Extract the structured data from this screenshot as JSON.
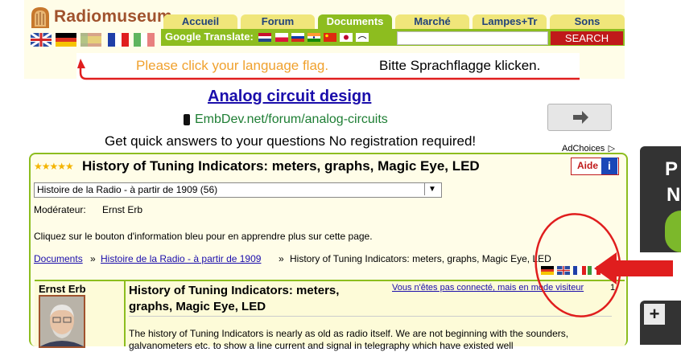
{
  "logo": {
    "text": "Radiomuseum"
  },
  "flags": [
    "uk-flag",
    "germany-flag",
    "spain-flag",
    "france-flag",
    "italy-flag"
  ],
  "nav": {
    "tabs": [
      "Accueil",
      "Forum",
      "Documents",
      "Marché",
      "Lampes+Tr",
      "Sons"
    ],
    "active": "Documents"
  },
  "translate": {
    "label": "Google Translate:",
    "flags": [
      "netherlands-flag",
      "poland-flag",
      "russia-flag",
      "india-flag",
      "china-flag",
      "japan-flag",
      "arabic-flag"
    ]
  },
  "search": {
    "placeholder": "",
    "button": "SEARCH"
  },
  "language_banner": {
    "fr_text": "Please click your language flag.",
    "de_text": "Bitte Sprachflagge klicken."
  },
  "ad": {
    "title": "Analog circuit design",
    "url": "EmbDev.net/forum/analog-circuits",
    "description": "Get quick answers to your questions No registration required!",
    "adchoices": "AdChoices"
  },
  "side": {
    "text_1": "P",
    "text_2": "N",
    "plus": "+"
  },
  "page": {
    "title": "History of Tuning Indicators: meters, graphs, Magic Eye, LED",
    "help_label": "Aide",
    "help_icon": "i",
    "category": "Histoire de la Radio - à partir de 1909  (56)",
    "moderator_label": "Modérateur:",
    "moderator_name": "Ernst Erb",
    "info": "Cliquez sur le bouton d'information bleu pour en apprendre plus sur cette page.",
    "breadcrumb": [
      "Documents",
      "Histoire de la Radio - à partir de 1909",
      "History of Tuning Indicators: meters, graphs, Magic Eye, LED"
    ],
    "breadcrumb_sep": "»"
  },
  "post": {
    "author": "Ernst Erb",
    "title": "History of Tuning Indicators: meters, graphs, Magic Eye, LED",
    "status": "Vous n'êtes pas connecté, mais en mode visiteur",
    "number": "1",
    "body": "The history of Tuning Indicators is nearly as old as radio itself. We are not beginning with the sounders, galvanometers etc. to show a line current and signal in telegraphy which have existed well"
  },
  "colors": {
    "accent_green": "#8dbd1f",
    "tab_yellow": "#f0e67a",
    "search_red": "#c0191a",
    "annotation_red": "#e01e1e"
  }
}
